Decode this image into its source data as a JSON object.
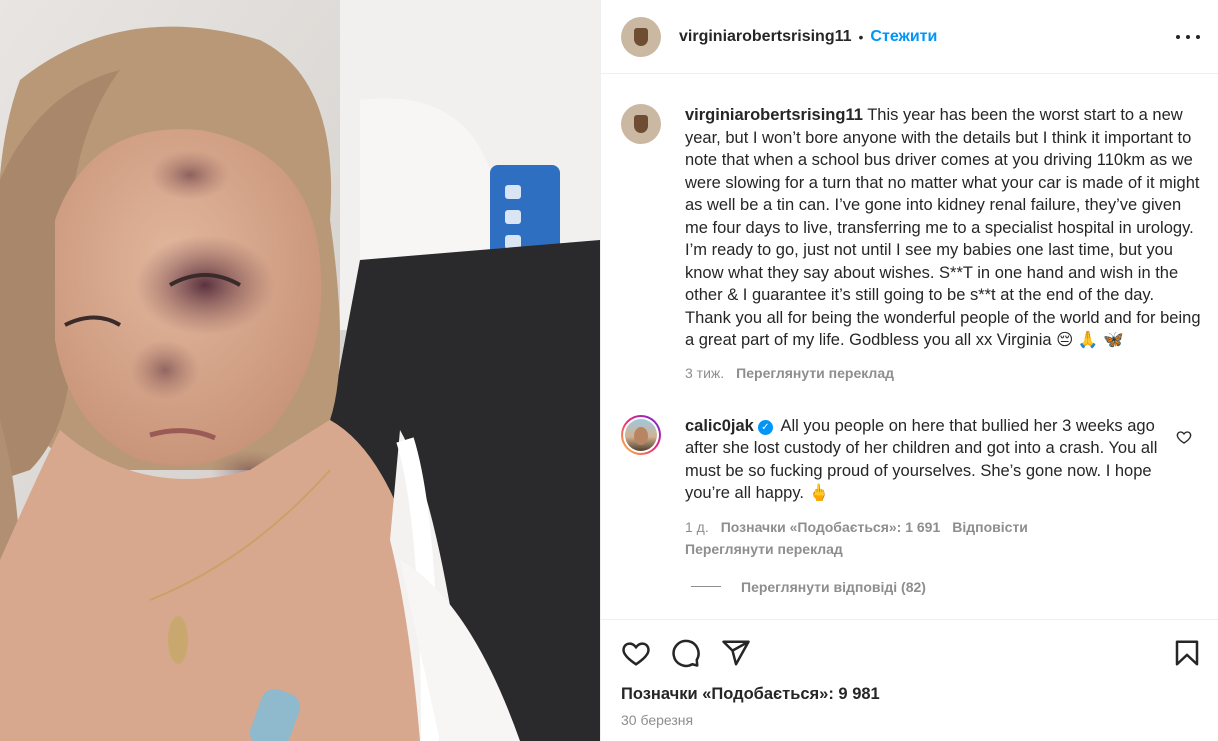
{
  "post": {
    "username": "virginiarobertsrising11",
    "separator": "•",
    "follow_label": "Стежити",
    "more_icon": "more-horizontal-icon",
    "media_alt": "photo"
  },
  "caption": {
    "username": "virginiarobertsrising11",
    "text": "This year has been the worst start to a new year, but I won’t bore anyone with the details but I think it important to note that when a school bus driver comes at you driving 110km as we were slowing for a turn that no matter what your car is made of it might as well be a tin can. I’ve gone into kidney renal failure, they’ve given me four days to live, transferring me to a specialist hospital in urology. I’m ready to go, just not until I see my babies one last time, but you know what they say about wishes. S**T in one hand and wish in the other & I guarantee it’s still going to be s**t at the end of the day. Thank you all for being the wonderful people of the world and for being a great part of my life. Godbless you all xx Virginia 😔 🙏 🦋",
    "time": "3 тиж.",
    "translate": "Переглянути переклад"
  },
  "comment": {
    "username": "calic0jak",
    "verified_mark": "✓",
    "text": "All you people on here that bullied her 3 weeks ago after she lost custody of her children and got into a crash. You all must be so fucking proud of yourselves. She’s gone now. I hope you’re all happy. 🖕",
    "time": "1 д.",
    "likes": "Позначки «Подобається»: 1 691",
    "reply": "Відповісти",
    "translate": "Переглянути переклад",
    "view_replies": "Переглянути відповіді (82)"
  },
  "footer": {
    "likes": "Позначки «Подобається»: 9 981",
    "date": "30 березня"
  },
  "colors": {
    "accent": "#0095f6",
    "muted": "#8e8e8e",
    "text": "#262626",
    "border": "#efefef"
  }
}
